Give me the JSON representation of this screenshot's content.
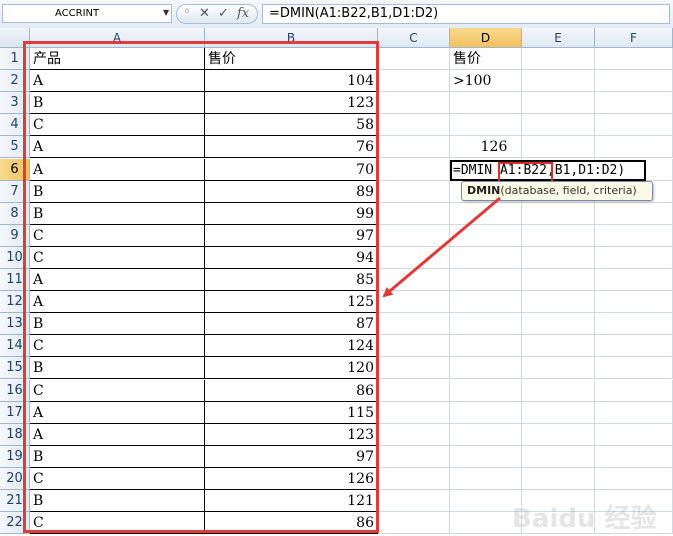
{
  "formula_bar": {
    "name_box": "ACCRINT",
    "cancel_icon": "✕",
    "enter_icon": "✓",
    "fx_label": "fx",
    "formula": "=DMIN(A1:B22,B1,D1:D2)"
  },
  "columns": [
    "A",
    "B",
    "C",
    "D",
    "E",
    "F"
  ],
  "rows": [
    "1",
    "2",
    "3",
    "4",
    "5",
    "6",
    "7",
    "8",
    "9",
    "10",
    "11",
    "12",
    "13",
    "14",
    "15",
    "16",
    "17",
    "18",
    "19",
    "20",
    "21",
    "22"
  ],
  "table": {
    "header": {
      "product": "产品",
      "price": "售价"
    },
    "records": [
      {
        "product": "A",
        "price": "104"
      },
      {
        "product": "B",
        "price": "123"
      },
      {
        "product": "C",
        "price": "58"
      },
      {
        "product": "A",
        "price": "76"
      },
      {
        "product": "A",
        "price": "70"
      },
      {
        "product": "B",
        "price": "89"
      },
      {
        "product": "B",
        "price": "99"
      },
      {
        "product": "C",
        "price": "97"
      },
      {
        "product": "C",
        "price": "94"
      },
      {
        "product": "A",
        "price": "85"
      },
      {
        "product": "A",
        "price": "125"
      },
      {
        "product": "B",
        "price": "87"
      },
      {
        "product": "C",
        "price": "124"
      },
      {
        "product": "B",
        "price": "120"
      },
      {
        "product": "C",
        "price": "86"
      },
      {
        "product": "A",
        "price": "115"
      },
      {
        "product": "A",
        "price": "123"
      },
      {
        "product": "B",
        "price": "97"
      },
      {
        "product": "C",
        "price": "126"
      },
      {
        "product": "B",
        "price": "121"
      },
      {
        "product": "C",
        "price": "86"
      }
    ]
  },
  "criteria": {
    "header": "售价",
    "value": ">100"
  },
  "result_value": "126",
  "editing": {
    "prefix": "=DMIN ",
    "ref": "A1:B22",
    "suffix": ",B1,D1:D2)"
  },
  "tooltip": {
    "func": "DMIN",
    "args": "(database, field, criteria)"
  },
  "watermark": "Baidu 经验",
  "colors": {
    "highlight_red": "#e03a3a",
    "selected_header": "#f1c15f"
  }
}
